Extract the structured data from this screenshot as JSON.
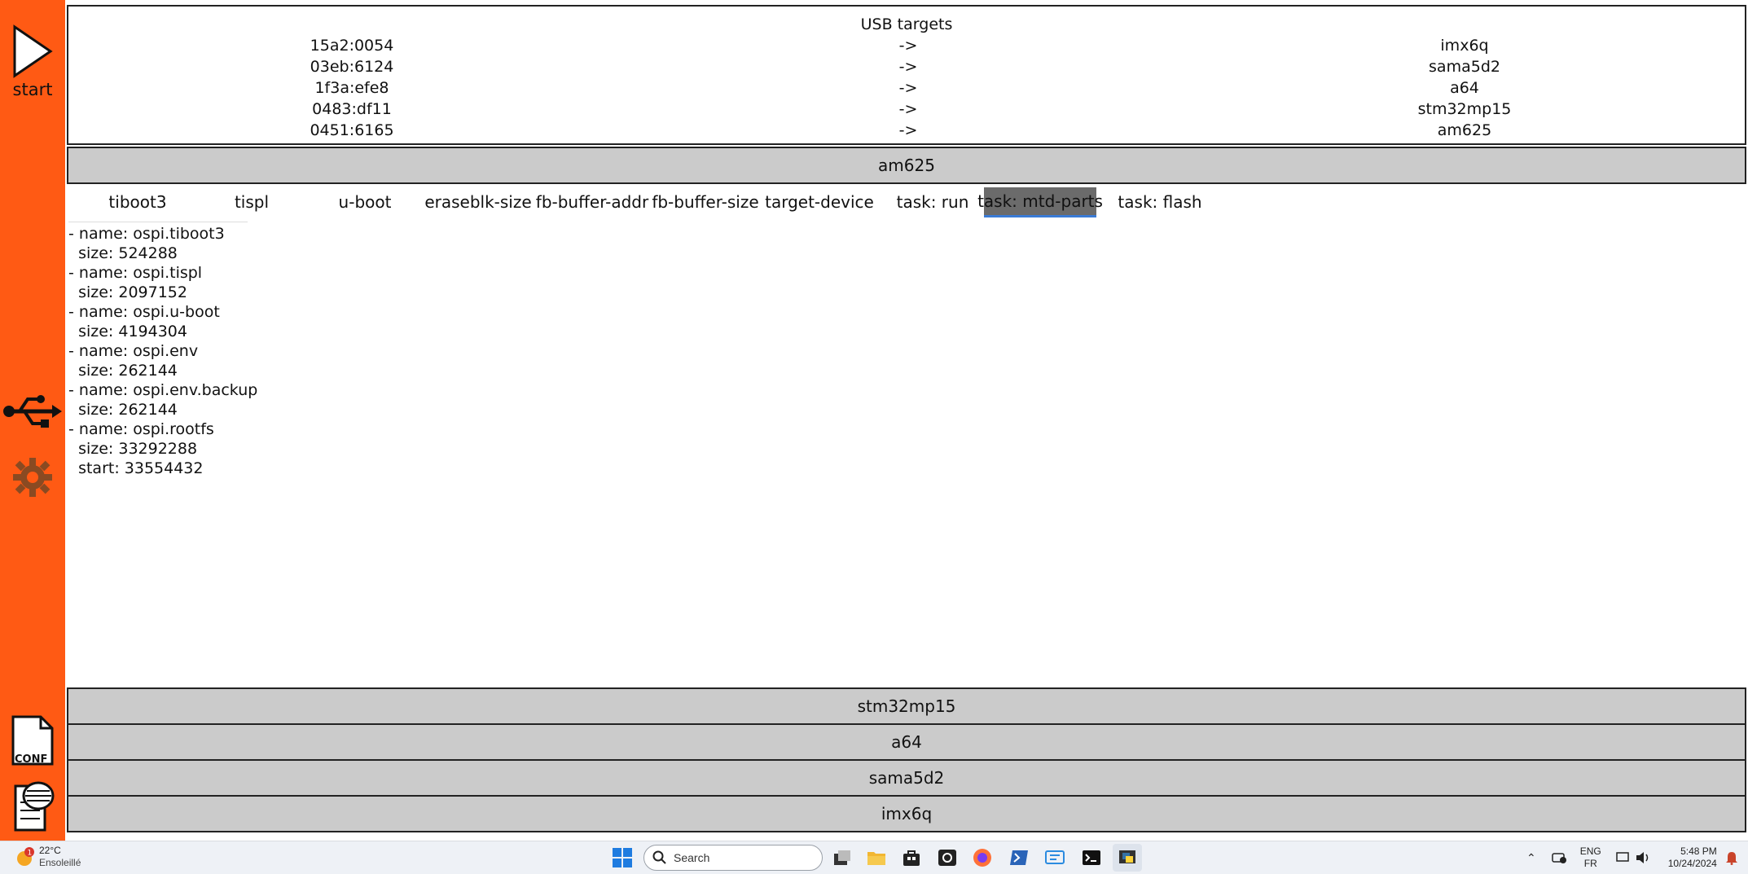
{
  "sidebar": {
    "start_label": "start",
    "conf_label": "CONF"
  },
  "usb_targets": {
    "title": "USB targets",
    "rows": [
      {
        "id": "15a2:0054",
        "arrow": "->",
        "target": "imx6q"
      },
      {
        "id": "03eb:6124",
        "arrow": "->",
        "target": "sama5d2"
      },
      {
        "id": "1f3a:efe8",
        "arrow": "->",
        "target": "a64"
      },
      {
        "id": "0483:df11",
        "arrow": "->",
        "target": "stm32mp15"
      },
      {
        "id": "0451:6165",
        "arrow": "->",
        "target": "am625"
      }
    ]
  },
  "boards": {
    "open": "am625",
    "collapsed": [
      "stm32mp15",
      "a64",
      "sama5d2",
      "imx6q"
    ]
  },
  "tabs": [
    {
      "label": "tiboot3"
    },
    {
      "label": "tispl"
    },
    {
      "label": "u-boot"
    },
    {
      "label": "eraseblk-size"
    },
    {
      "label": "fb-buffer-addr"
    },
    {
      "label": "fb-buffer-size"
    },
    {
      "label": "target-device"
    },
    {
      "label": "task: run"
    },
    {
      "label": "task: mtd-parts"
    },
    {
      "label": "task: flash"
    }
  ],
  "active_tab": "task: mtd-parts",
  "content_lines": [
    "- name: ospi.tiboot3",
    "  size: 524288",
    "- name: ospi.tispl",
    "  size: 2097152",
    "- name: ospi.u-boot",
    "  size: 4194304",
    "- name: ospi.env",
    "  size: 262144",
    "- name: ospi.env.backup",
    "  size: 262144",
    "- name: ospi.rootfs",
    "  size: 33292288",
    "  start: 33554432"
  ],
  "taskbar": {
    "weather_temp": "22°C",
    "weather_desc": "Ensoleillé",
    "weather_badge": "1",
    "search_placeholder": "Search",
    "lang_top": "ENG",
    "lang_bottom": "FR",
    "time": "5:48 PM",
    "date": "10/24/2024"
  },
  "colors": {
    "sidebar": "#ff5a14",
    "accordion_header": "#cbcbcb",
    "active_tab": "#6b6b6b"
  }
}
